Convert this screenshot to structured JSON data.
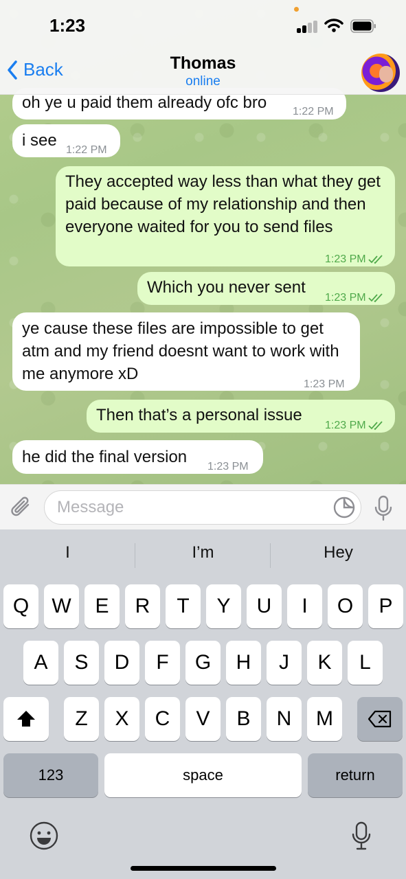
{
  "status": {
    "time": "1:23"
  },
  "header": {
    "back_label": "Back",
    "title": "Thomas",
    "subtitle": "online"
  },
  "messages": [
    {
      "dir": "in",
      "text": "oh ye u paid them already ofc bro",
      "time": "1:22 PM"
    },
    {
      "dir": "in",
      "text": "i see",
      "time": "1:22 PM"
    },
    {
      "dir": "out",
      "text": "They accepted way less than what they get paid because of my relationship and then everyone waited for you to send files",
      "time": "1:23 PM"
    },
    {
      "dir": "out",
      "text": "Which you never sent",
      "time": "1:23 PM"
    },
    {
      "dir": "in",
      "text": "ye cause these files are impossible to get atm and my friend doesnt want to work with me anymore xD",
      "time": "1:23 PM"
    },
    {
      "dir": "out",
      "text": "Then that’s a personal issue",
      "time": "1:23 PM"
    },
    {
      "dir": "in",
      "text": "he did the final version",
      "time": "1:23 PM"
    }
  ],
  "input": {
    "placeholder": "Message"
  },
  "keyboard": {
    "suggestions": [
      "I",
      "I’m",
      "Hey"
    ],
    "row1": [
      "Q",
      "W",
      "E",
      "R",
      "T",
      "Y",
      "U",
      "I",
      "O",
      "P"
    ],
    "row2": [
      "A",
      "S",
      "D",
      "F",
      "G",
      "H",
      "J",
      "K",
      "L"
    ],
    "row3": [
      "Z",
      "X",
      "C",
      "V",
      "B",
      "N",
      "M"
    ],
    "numbers_label": "123",
    "space_label": "space",
    "return_label": "return"
  },
  "colors": {
    "accent": "#1a7ef0",
    "outgoing_bubble": "#e2fcc8",
    "incoming_bubble": "#ffffff",
    "read_check": "#4fa94a"
  },
  "icons": [
    "back-chevron-icon",
    "signal-icon",
    "wifi-icon",
    "battery-icon",
    "attach-icon",
    "sticker-icon",
    "microphone-icon",
    "shift-icon",
    "backspace-icon",
    "emoji-icon"
  ]
}
